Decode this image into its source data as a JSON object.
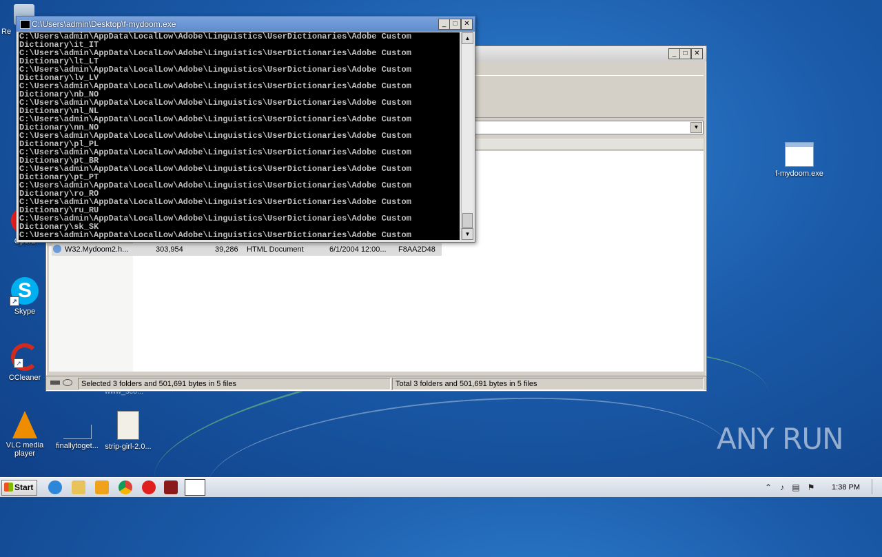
{
  "console": {
    "title": "C:\\Users\\admin\\Desktop\\f-mydoom.exe",
    "lines": [
      "C:\\Users\\admin\\AppData\\LocalLow\\Adobe\\Linguistics\\UserDictionaries\\Adobe Custom",
      "Dictionary\\it_IT",
      "C:\\Users\\admin\\AppData\\LocalLow\\Adobe\\Linguistics\\UserDictionaries\\Adobe Custom",
      "Dictionary\\lt_LT",
      "C:\\Users\\admin\\AppData\\LocalLow\\Adobe\\Linguistics\\UserDictionaries\\Adobe Custom",
      "Dictionary\\lv_LV",
      "C:\\Users\\admin\\AppData\\LocalLow\\Adobe\\Linguistics\\UserDictionaries\\Adobe Custom",
      "Dictionary\\nb_NO",
      "C:\\Users\\admin\\AppData\\LocalLow\\Adobe\\Linguistics\\UserDictionaries\\Adobe Custom",
      "Dictionary\\nl_NL",
      "C:\\Users\\admin\\AppData\\LocalLow\\Adobe\\Linguistics\\UserDictionaries\\Adobe Custom",
      "Dictionary\\nn_NO",
      "C:\\Users\\admin\\AppData\\LocalLow\\Adobe\\Linguistics\\UserDictionaries\\Adobe Custom",
      "Dictionary\\pl_PL",
      "C:\\Users\\admin\\AppData\\LocalLow\\Adobe\\Linguistics\\UserDictionaries\\Adobe Custom",
      "Dictionary\\pt_BR",
      "C:\\Users\\admin\\AppData\\LocalLow\\Adobe\\Linguistics\\UserDictionaries\\Adobe Custom",
      "Dictionary\\pt_PT",
      "C:\\Users\\admin\\AppData\\LocalLow\\Adobe\\Linguistics\\UserDictionaries\\Adobe Custom",
      "Dictionary\\ro_RO",
      "C:\\Users\\admin\\AppData\\LocalLow\\Adobe\\Linguistics\\UserDictionaries\\Adobe Custom",
      "Dictionary\\ru_RU",
      "C:\\Users\\admin\\AppData\\LocalLow\\Adobe\\Linguistics\\UserDictionaries\\Adobe Custom",
      "Dictionary\\sk_SK",
      "C:\\Users\\admin\\AppData\\LocalLow\\Adobe\\Linguistics\\UserDictionaries\\Adobe Custom"
    ]
  },
  "explorer": {
    "file_row": {
      "name": "W32.Mydoom2.h...",
      "size1": "303,954",
      "size2": "39,286",
      "type": "HTML Document",
      "date": "6/1/2004 12:00...",
      "crc": "F8AA2D48"
    },
    "status_left": "Selected 3 folders and 501,691 bytes in 5 files",
    "status_right": "Total 3 folders and 501,691 bytes in 5 files"
  },
  "desktop_icons": {
    "recycle": "Re",
    "opera": "Opera",
    "skype": "Skype",
    "ccleaner": "CCleaner",
    "vlc": "VLC media player",
    "finally": "finallytoget...",
    "strip": "strip-girl-2.0...",
    "fmydoom": "f-mydoom.exe",
    "behind_text": "www_sc0..."
  },
  "taskbar": {
    "start_label": "Start",
    "clock": "1:38 PM"
  },
  "watermark": "ANY RUN"
}
